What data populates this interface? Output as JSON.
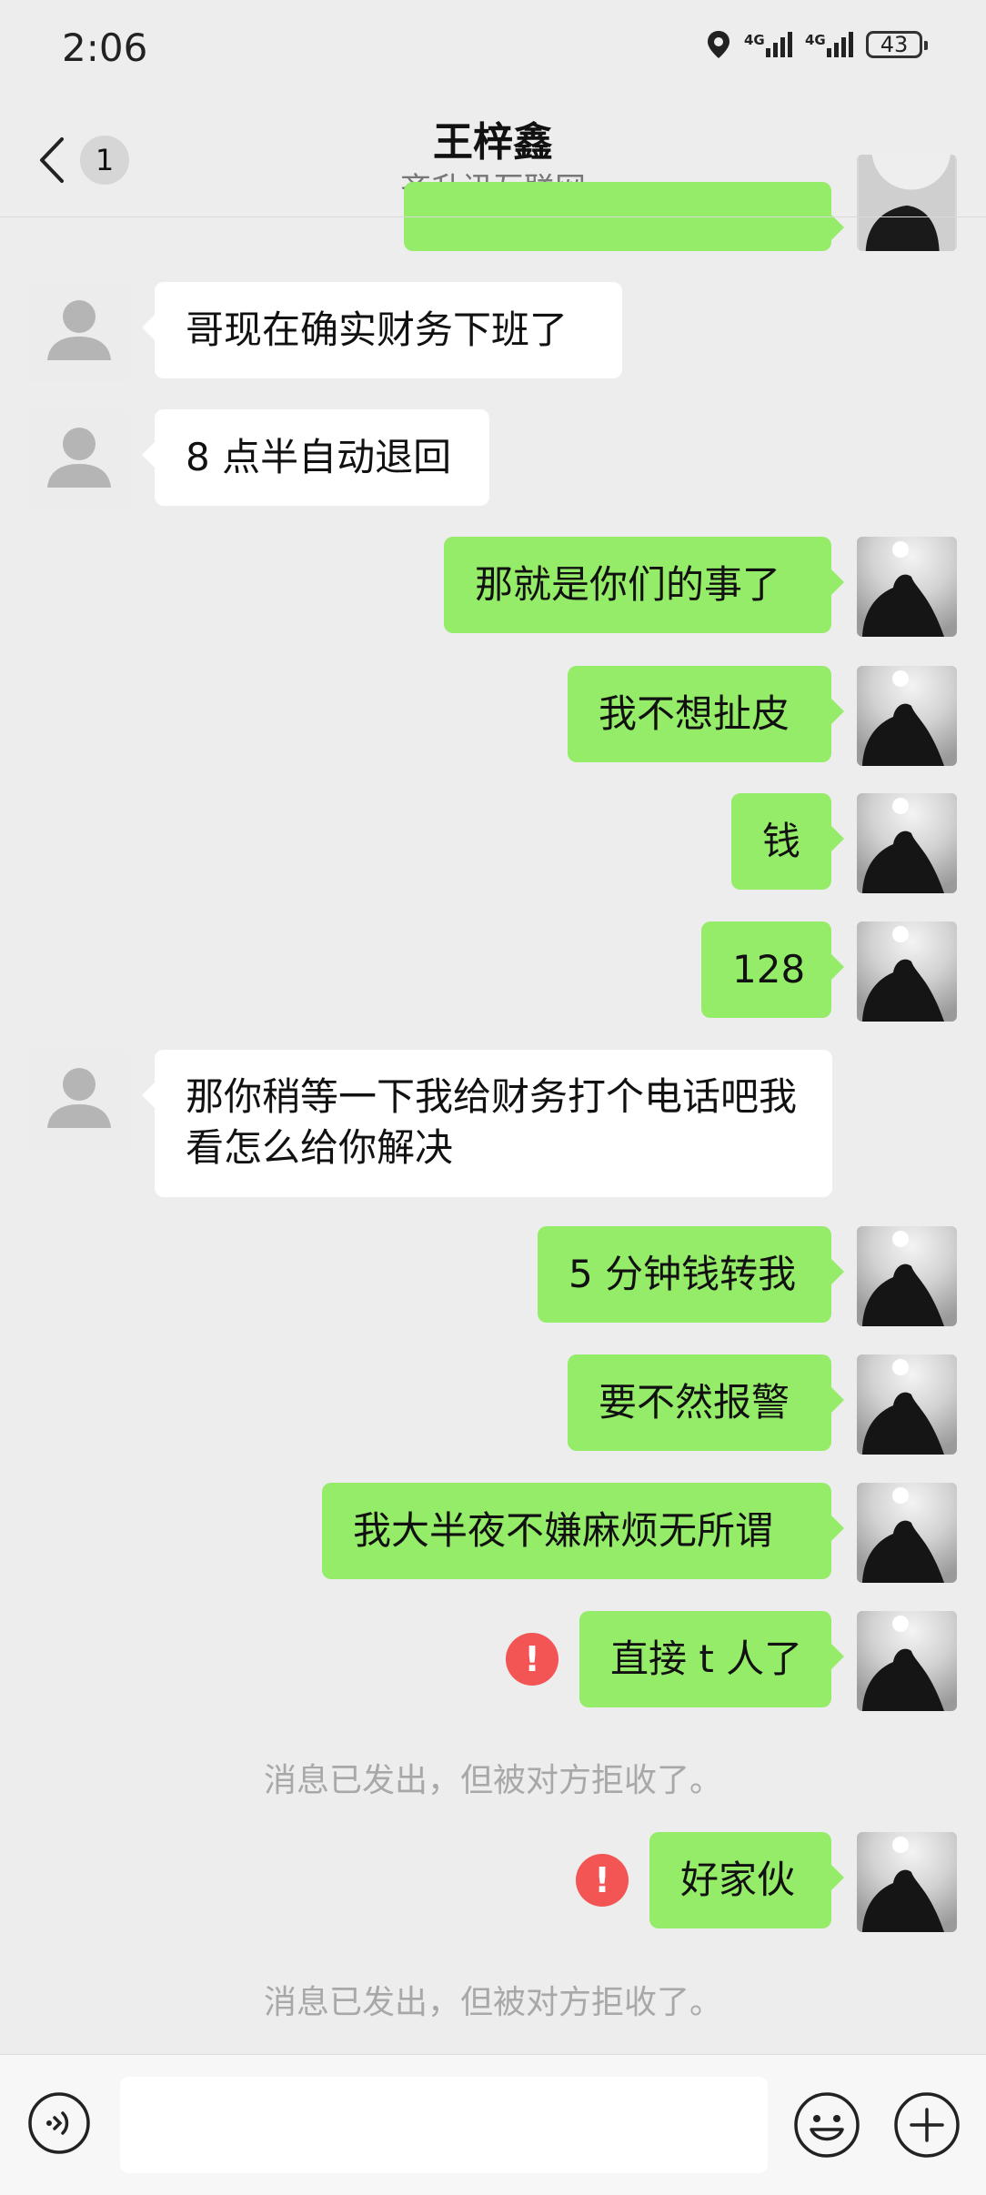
{
  "status_bar": {
    "time": "2:06",
    "net1": "4G",
    "net2": "4G",
    "battery": "43"
  },
  "header": {
    "back_count": "1",
    "title": "王梓鑫",
    "subtitle": "齐升讯互联网"
  },
  "messages": [
    {
      "side": "in",
      "text": "哥现在确实财务下班了"
    },
    {
      "side": "in",
      "text": "8 点半自动退回"
    },
    {
      "side": "out",
      "text": "那就是你们的事了"
    },
    {
      "side": "out",
      "text": "我不想扯皮"
    },
    {
      "side": "out",
      "text": "钱"
    },
    {
      "side": "out",
      "text": "128"
    },
    {
      "side": "in",
      "text": "那你稍等一下我给财务打个电话吧我看怎么给你解决"
    },
    {
      "side": "out",
      "text": "5 分钟钱转我"
    },
    {
      "side": "out",
      "text": "要不然报警"
    },
    {
      "side": "out",
      "text": "我大半夜不嫌麻烦无所谓"
    },
    {
      "side": "out",
      "text": "直接 t 人了",
      "failed": true
    },
    {
      "side": "out",
      "text": "好家伙",
      "failed": true
    }
  ],
  "system_notes": [
    "消息已发出，但被对方拒收了。",
    "消息已发出，但被对方拒收了。"
  ],
  "error_mark": "!",
  "input": {
    "value": "",
    "placeholder": ""
  },
  "colors": {
    "background": "#ededed",
    "outgoing_bubble": "#95ec69",
    "incoming_bubble": "#ffffff",
    "error": "#f35454",
    "system_text": "#a8a8a8"
  },
  "icons": {
    "back": "chevron-left-icon",
    "more": "more-dots-icon",
    "voice": "voice-icon",
    "emoji": "emoji-icon",
    "plus": "plus-icon",
    "location": "location-icon",
    "error": "error-icon",
    "default_avatar": "default-avatar-icon",
    "user_avatar": "user-photo-avatar"
  }
}
